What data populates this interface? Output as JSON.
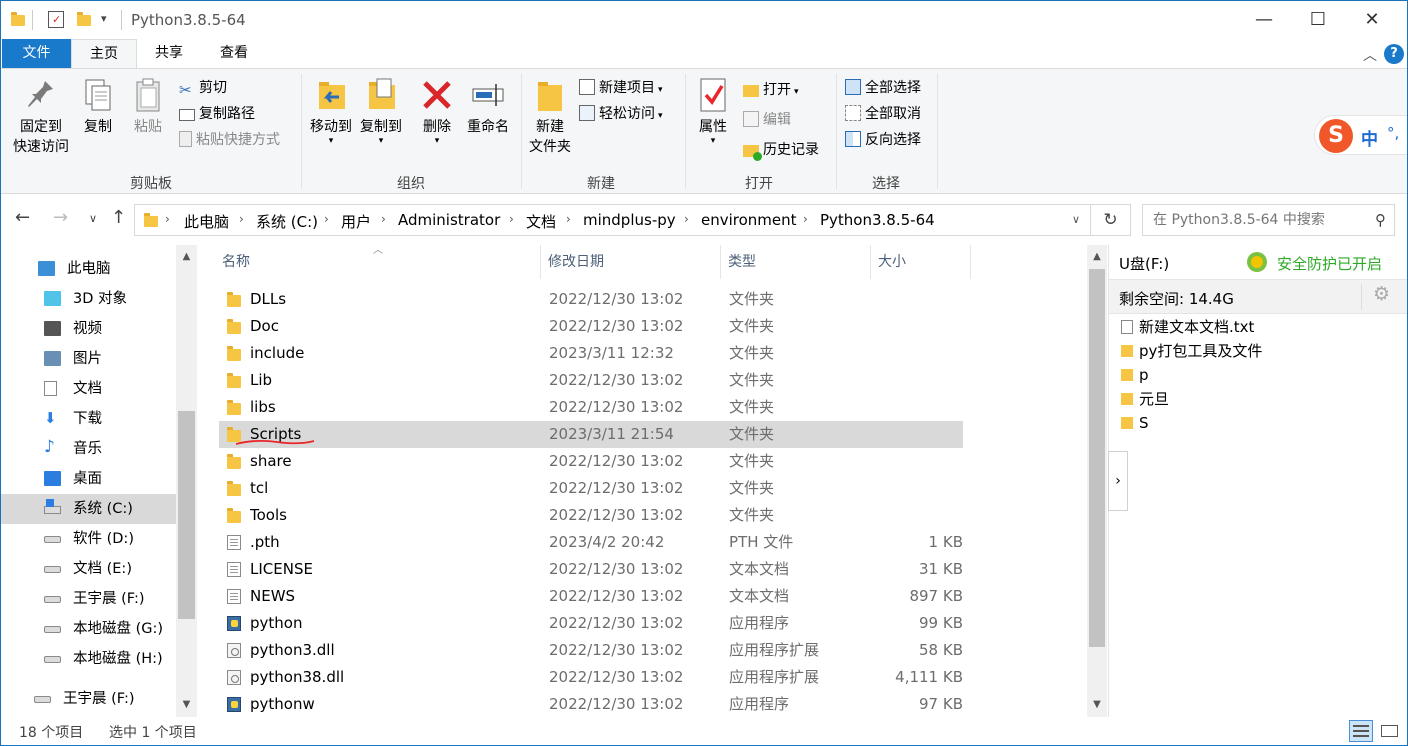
{
  "window": {
    "title": "Python3.8.5-64"
  },
  "title_buttons": {
    "minimize": "—",
    "maximize": "☐",
    "close": "✕"
  },
  "tabs": {
    "file": "文件",
    "home": "主页",
    "share": "共享",
    "view": "查看"
  },
  "ribbon": {
    "clipboard": {
      "group": "剪贴板",
      "pin_line1": "固定到",
      "pin_line2": "快速访问",
      "copy": "复制",
      "paste": "粘贴",
      "cut": "剪切",
      "copy_path": "复制路径",
      "paste_shortcut": "粘贴快捷方式"
    },
    "organize": {
      "group": "组织",
      "move_to": "移动到",
      "copy_to": "复制到",
      "delete": "删除",
      "rename": "重命名"
    },
    "new": {
      "group": "新建",
      "new_folder_line1": "新建",
      "new_folder_line2": "文件夹",
      "new_item": "新建项目",
      "easy_access": "轻松访问"
    },
    "open": {
      "group": "打开",
      "properties": "属性",
      "open": "打开",
      "edit": "编辑",
      "history": "历史记录"
    },
    "select": {
      "group": "选择",
      "select_all": "全部选择",
      "select_none": "全部取消",
      "invert": "反向选择"
    }
  },
  "breadcrumbs": [
    "此电脑",
    "系统 (C:)",
    "用户",
    "Administrator",
    "文档",
    "mindplus-py",
    "environment",
    "Python3.8.5-64"
  ],
  "search": {
    "placeholder": "在 Python3.8.5-64 中搜索"
  },
  "navpane": {
    "items": [
      {
        "label": "此电脑",
        "icon": "computer-icon"
      },
      {
        "label": "3D 对象",
        "icon": "cube-icon"
      },
      {
        "label": "视频",
        "icon": "video-icon"
      },
      {
        "label": "图片",
        "icon": "picture-icon"
      },
      {
        "label": "文档",
        "icon": "document-icon"
      },
      {
        "label": "下载",
        "icon": "download-icon"
      },
      {
        "label": "音乐",
        "icon": "music-icon"
      },
      {
        "label": "桌面",
        "icon": "desktop-icon"
      },
      {
        "label": "系统 (C:)",
        "icon": "windows-drive-icon"
      },
      {
        "label": "软件 (D:)",
        "icon": "drive-icon"
      },
      {
        "label": "文档 (E:)",
        "icon": "drive-icon"
      },
      {
        "label": "王宇晨 (F:)",
        "icon": "drive-icon"
      },
      {
        "label": "本地磁盘 (G:)",
        "icon": "drive-icon"
      },
      {
        "label": "本地磁盘 (H:)",
        "icon": "drive-icon"
      },
      {
        "label": "王宇晨 (F:)",
        "icon": "usb-drive-icon"
      }
    ]
  },
  "columns": {
    "name": "名称",
    "date": "修改日期",
    "type": "类型",
    "size": "大小"
  },
  "files": [
    {
      "name": "DLLs",
      "date": "2022/12/30 13:02",
      "type": "文件夹",
      "size": "",
      "icon": "folder"
    },
    {
      "name": "Doc",
      "date": "2022/12/30 13:02",
      "type": "文件夹",
      "size": "",
      "icon": "folder"
    },
    {
      "name": "include",
      "date": "2023/3/11 12:32",
      "type": "文件夹",
      "size": "",
      "icon": "folder"
    },
    {
      "name": "Lib",
      "date": "2022/12/30 13:02",
      "type": "文件夹",
      "size": "",
      "icon": "folder"
    },
    {
      "name": "libs",
      "date": "2022/12/30 13:02",
      "type": "文件夹",
      "size": "",
      "icon": "folder"
    },
    {
      "name": "Scripts",
      "date": "2023/3/11 21:54",
      "type": "文件夹",
      "size": "",
      "icon": "folder"
    },
    {
      "name": "share",
      "date": "2022/12/30 13:02",
      "type": "文件夹",
      "size": "",
      "icon": "folder"
    },
    {
      "name": "tcl",
      "date": "2022/12/30 13:02",
      "type": "文件夹",
      "size": "",
      "icon": "folder"
    },
    {
      "name": "Tools",
      "date": "2022/12/30 13:02",
      "type": "文件夹",
      "size": "",
      "icon": "folder"
    },
    {
      "name": ".pth",
      "date": "2023/4/2 20:42",
      "type": "PTH 文件",
      "size": "1 KB",
      "icon": "doc"
    },
    {
      "name": "LICENSE",
      "date": "2022/12/30 13:02",
      "type": "文本文档",
      "size": "31 KB",
      "icon": "doc"
    },
    {
      "name": "NEWS",
      "date": "2022/12/30 13:02",
      "type": "文本文档",
      "size": "897 KB",
      "icon": "doc"
    },
    {
      "name": "python",
      "date": "2022/12/30 13:02",
      "type": "应用程序",
      "size": "99 KB",
      "icon": "app"
    },
    {
      "name": "python3.dll",
      "date": "2022/12/30 13:02",
      "type": "应用程序扩展",
      "size": "58 KB",
      "icon": "dll"
    },
    {
      "name": "python38.dll",
      "date": "2022/12/30 13:02",
      "type": "应用程序扩展",
      "size": "4,111 KB",
      "icon": "dll"
    },
    {
      "name": "pythonw",
      "date": "2022/12/30 13:02",
      "type": "应用程序",
      "size": "97 KB",
      "icon": "app"
    }
  ],
  "selected_file": "Scripts",
  "preview": {
    "drive": "U盘(F:)",
    "security": "安全防护已开启",
    "free_space": "剩余空间: 14.4G",
    "items": [
      {
        "label": "新建文本文档.txt",
        "icon": "doc"
      },
      {
        "label": "py打包工具及文件",
        "icon": "folder"
      },
      {
        "label": "p",
        "icon": "folder"
      },
      {
        "label": "元旦",
        "icon": "folder"
      },
      {
        "label": "S",
        "icon": "folder"
      }
    ]
  },
  "ime": {
    "label": "中",
    "punct": "°,"
  },
  "status": {
    "count": "18 个项目",
    "selected": "选中 1 个项目"
  },
  "colors": {
    "accent": "#1979ca",
    "selection": "#d9d9d9",
    "annotation": "#e8262b",
    "security_green": "#2da827"
  }
}
